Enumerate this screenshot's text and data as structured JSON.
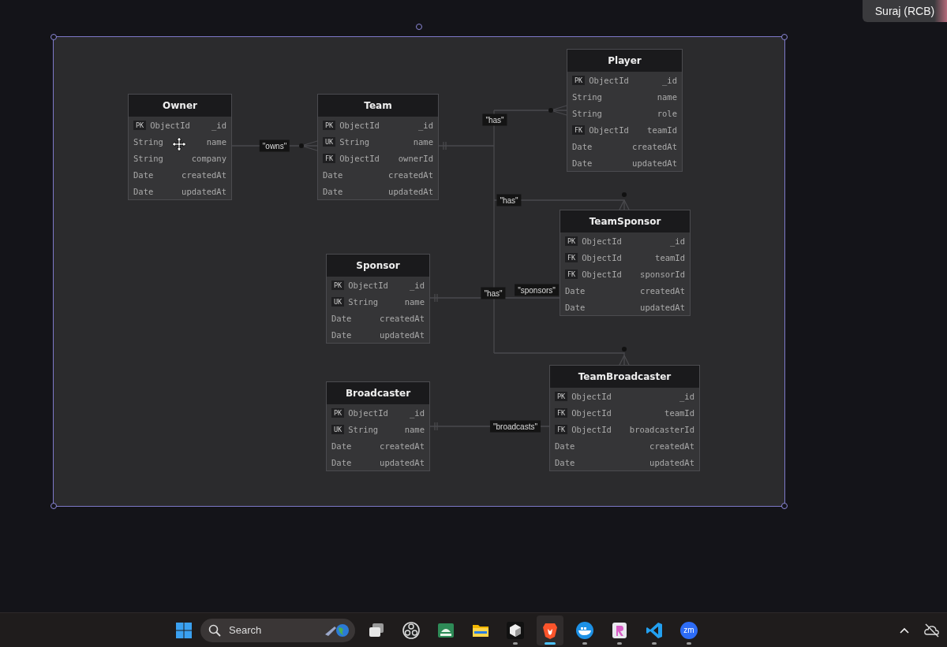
{
  "participant": {
    "name": "Suraj (RCB)"
  },
  "tables": [
    {
      "name": "Owner",
      "fields": [
        {
          "key": "PK",
          "type": "ObjectId",
          "name": "_id"
        },
        {
          "type": "String",
          "name": "name"
        },
        {
          "type": "String",
          "name": "company"
        },
        {
          "type": "Date",
          "name": "createdAt"
        },
        {
          "type": "Date",
          "name": "updatedAt"
        }
      ]
    },
    {
      "name": "Team",
      "fields": [
        {
          "key": "PK",
          "type": "ObjectId",
          "name": "_id"
        },
        {
          "key": "UK",
          "type": "String",
          "name": "name"
        },
        {
          "key": "FK",
          "type": "ObjectId",
          "name": "ownerId"
        },
        {
          "type": "Date",
          "name": "createdAt"
        },
        {
          "type": "Date",
          "name": "updatedAt"
        }
      ]
    },
    {
      "name": "Player",
      "fields": [
        {
          "key": "PK",
          "type": "ObjectId",
          "name": "_id"
        },
        {
          "type": "String",
          "name": "name"
        },
        {
          "type": "String",
          "name": "role"
        },
        {
          "key": "FK",
          "type": "ObjectId",
          "name": "teamId"
        },
        {
          "type": "Date",
          "name": "createdAt"
        },
        {
          "type": "Date",
          "name": "updatedAt"
        }
      ]
    },
    {
      "name": "TeamSponsor",
      "fields": [
        {
          "key": "PK",
          "type": "ObjectId",
          "name": "_id"
        },
        {
          "key": "FK",
          "type": "ObjectId",
          "name": "teamId"
        },
        {
          "key": "FK",
          "type": "ObjectId",
          "name": "sponsorId"
        },
        {
          "type": "Date",
          "name": "createdAt"
        },
        {
          "type": "Date",
          "name": "updatedAt"
        }
      ]
    },
    {
      "name": "Sponsor",
      "fields": [
        {
          "key": "PK",
          "type": "ObjectId",
          "name": "_id"
        },
        {
          "key": "UK",
          "type": "String",
          "name": "name"
        },
        {
          "type": "Date",
          "name": "createdAt"
        },
        {
          "type": "Date",
          "name": "updatedAt"
        }
      ]
    },
    {
      "name": "Broadcaster",
      "fields": [
        {
          "key": "PK",
          "type": "ObjectId",
          "name": "_id"
        },
        {
          "key": "UK",
          "type": "String",
          "name": "name"
        },
        {
          "type": "Date",
          "name": "createdAt"
        },
        {
          "type": "Date",
          "name": "updatedAt"
        }
      ]
    },
    {
      "name": "TeamBroadcaster",
      "fields": [
        {
          "key": "PK",
          "type": "ObjectId",
          "name": "_id"
        },
        {
          "key": "FK",
          "type": "ObjectId",
          "name": "teamId"
        },
        {
          "key": "FK",
          "type": "ObjectId",
          "name": "broadcasterId"
        },
        {
          "type": "Date",
          "name": "createdAt"
        },
        {
          "type": "Date",
          "name": "updatedAt"
        }
      ]
    }
  ],
  "relations": [
    {
      "label": "\"owns\""
    },
    {
      "label": "\"has\""
    },
    {
      "label": "\"has\""
    },
    {
      "label": "\"has\""
    },
    {
      "label": "\"sponsors\""
    },
    {
      "label": "\"broadcasts\""
    }
  ],
  "taskbar": {
    "search": {
      "placeholder": "Search"
    },
    "apps": [
      {
        "kind": "taskview",
        "running": false,
        "selected": false
      },
      {
        "kind": "obs",
        "running": false,
        "selected": false
      },
      {
        "kind": "android",
        "running": false,
        "selected": false
      },
      {
        "kind": "folder",
        "running": false,
        "selected": false
      },
      {
        "kind": "cube",
        "running": true,
        "selected": false
      },
      {
        "kind": "brave",
        "running": true,
        "selected": true
      },
      {
        "kind": "docker",
        "running": true,
        "selected": false
      },
      {
        "kind": "paint",
        "running": true,
        "selected": false
      },
      {
        "kind": "vscode",
        "running": true,
        "selected": false
      },
      {
        "kind": "zoom",
        "running": true,
        "selected": false,
        "text": "zm"
      }
    ]
  }
}
